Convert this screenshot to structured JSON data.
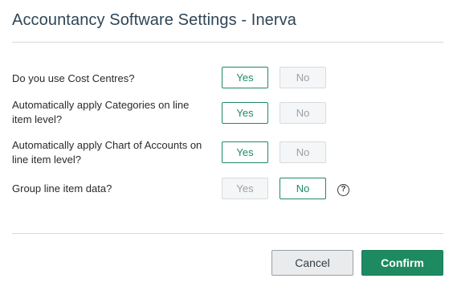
{
  "dialog": {
    "title": "Accountancy Software Settings - Inerva"
  },
  "settings": [
    {
      "question": "Do you use Cost Centres?",
      "yes_label": "Yes",
      "no_label": "No",
      "selected": "Yes"
    },
    {
      "question": "Automatically apply Categories on line item level?",
      "yes_label": "Yes",
      "no_label": "No",
      "selected": "Yes"
    },
    {
      "question": "Automatically apply Chart of Accounts on line item level?",
      "yes_label": "Yes",
      "no_label": "No",
      "selected": "Yes"
    },
    {
      "question": "Group line item data?",
      "yes_label": "Yes",
      "no_label": "No",
      "selected": "No",
      "help_icon": "question-circle-icon",
      "help_glyph": "?"
    }
  ],
  "footer": {
    "cancel_label": "Cancel",
    "confirm_label": "Confirm"
  },
  "colors": {
    "accent": "#1e8a62",
    "title": "#2f4556",
    "inactive_bg": "#f4f6f7"
  }
}
